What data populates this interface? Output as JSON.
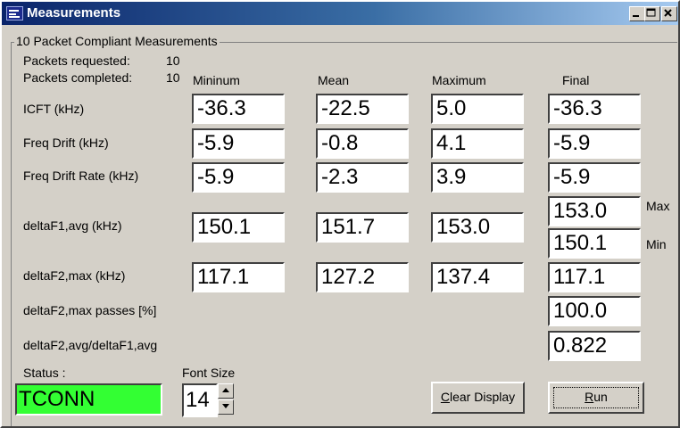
{
  "window": {
    "title": "Measurements"
  },
  "group": {
    "label": "10 Packet Compliant Measurements"
  },
  "packets": {
    "requested_label": "Packets requested:",
    "requested_value": "10",
    "completed_label": "Packets completed:",
    "completed_value": "10"
  },
  "columns": {
    "min": "Mininum",
    "mean": "Mean",
    "max": "Maximum",
    "final": "Final"
  },
  "rows": [
    {
      "label": "ICFT (kHz)",
      "min": "-36.3",
      "mean": "-22.5",
      "max": "5.0",
      "final": "-36.3"
    },
    {
      "label": "Freq Drift (kHz)",
      "min": "-5.9",
      "mean": "-0.8",
      "max": "4.1",
      "final": "-5.9"
    },
    {
      "label": "Freq Drift Rate (kHz)",
      "min": "-5.9",
      "mean": "-2.3",
      "max": "3.9",
      "final": "-5.9"
    },
    {
      "label": "deltaF1,avg (kHz)",
      "min": "150.1",
      "mean": "151.7",
      "max": "153.0",
      "final_max": "153.0",
      "final_min": "150.1",
      "max_tag": "Max",
      "min_tag": "Min"
    },
    {
      "label": "deltaF2,max (kHz)",
      "min": "117.1",
      "mean": "127.2",
      "max": "137.4",
      "final": "117.1"
    },
    {
      "label": "deltaF2,max passes [%]",
      "final": "100.0"
    },
    {
      "label": "deltaF2,avg/deltaF1,avg",
      "final": "0.822"
    }
  ],
  "status": {
    "label": "Status :",
    "value": "TCONN",
    "color": "#33ff33"
  },
  "font_size": {
    "label": "Font Size",
    "value": "14"
  },
  "buttons": {
    "clear_prefix": "",
    "clear_accel": "C",
    "clear_rest": "lear Display",
    "run_accel": "R",
    "run_rest": "un"
  },
  "icons": [
    "app-icon",
    "minimize-icon",
    "maximize-icon",
    "close-icon",
    "spin-up-icon",
    "spin-down-icon"
  ]
}
